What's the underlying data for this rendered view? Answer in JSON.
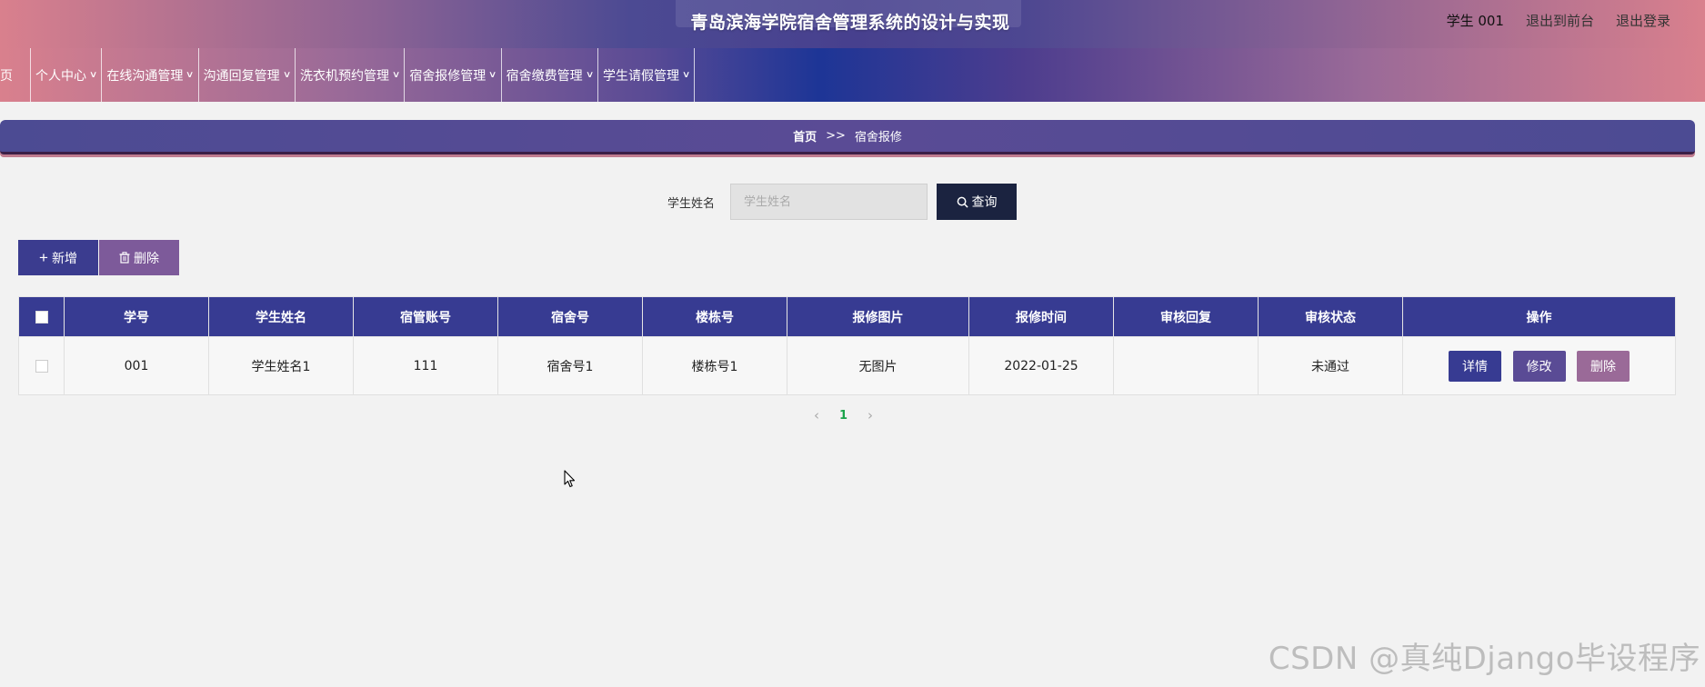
{
  "header": {
    "title": "青岛滨海学院宿舍管理系统的设计与实现",
    "user": "学生 001",
    "links": [
      "退出到前台",
      "退出登录"
    ]
  },
  "nav": {
    "items": [
      {
        "label": "页",
        "has_dropdown": false
      },
      {
        "label": "个人中心",
        "has_dropdown": true
      },
      {
        "label": "在线沟通管理",
        "has_dropdown": true
      },
      {
        "label": "沟通回复管理",
        "has_dropdown": true
      },
      {
        "label": "洗衣机预约管理",
        "has_dropdown": true
      },
      {
        "label": "宿舍报修管理",
        "has_dropdown": true
      },
      {
        "label": "宿舍缴费管理",
        "has_dropdown": true
      },
      {
        "label": "学生请假管理",
        "has_dropdown": true
      }
    ]
  },
  "breadcrumb": {
    "home": "首页",
    "separator": ">>",
    "current": "宿舍报修"
  },
  "search": {
    "label": "学生姓名",
    "placeholder": "学生姓名",
    "value": "",
    "button": "查询"
  },
  "actions": {
    "add": "新增",
    "delete": "删除"
  },
  "table": {
    "columns": [
      "学号",
      "学生姓名",
      "宿管账号",
      "宿舍号",
      "楼栋号",
      "报修图片",
      "报修时间",
      "审核回复",
      "审核状态",
      "操作"
    ],
    "rows": [
      {
        "cells": [
          "001",
          "学生姓名1",
          "111",
          "宿舍号1",
          "楼栋号1",
          "无图片",
          "2022-01-25",
          "",
          "未通过"
        ],
        "ops": [
          "详情",
          "修改",
          "删除"
        ]
      }
    ]
  },
  "pagination": {
    "current": "1",
    "prev": "‹",
    "next": "›"
  },
  "watermark": "CSDN @真纯Django毕设程序",
  "colors": {
    "primary": "#373b92",
    "secondary": "#5a4b95",
    "accent": "#9a6a98",
    "search_button": "#1b2340",
    "active_page": "#1aa34a"
  }
}
